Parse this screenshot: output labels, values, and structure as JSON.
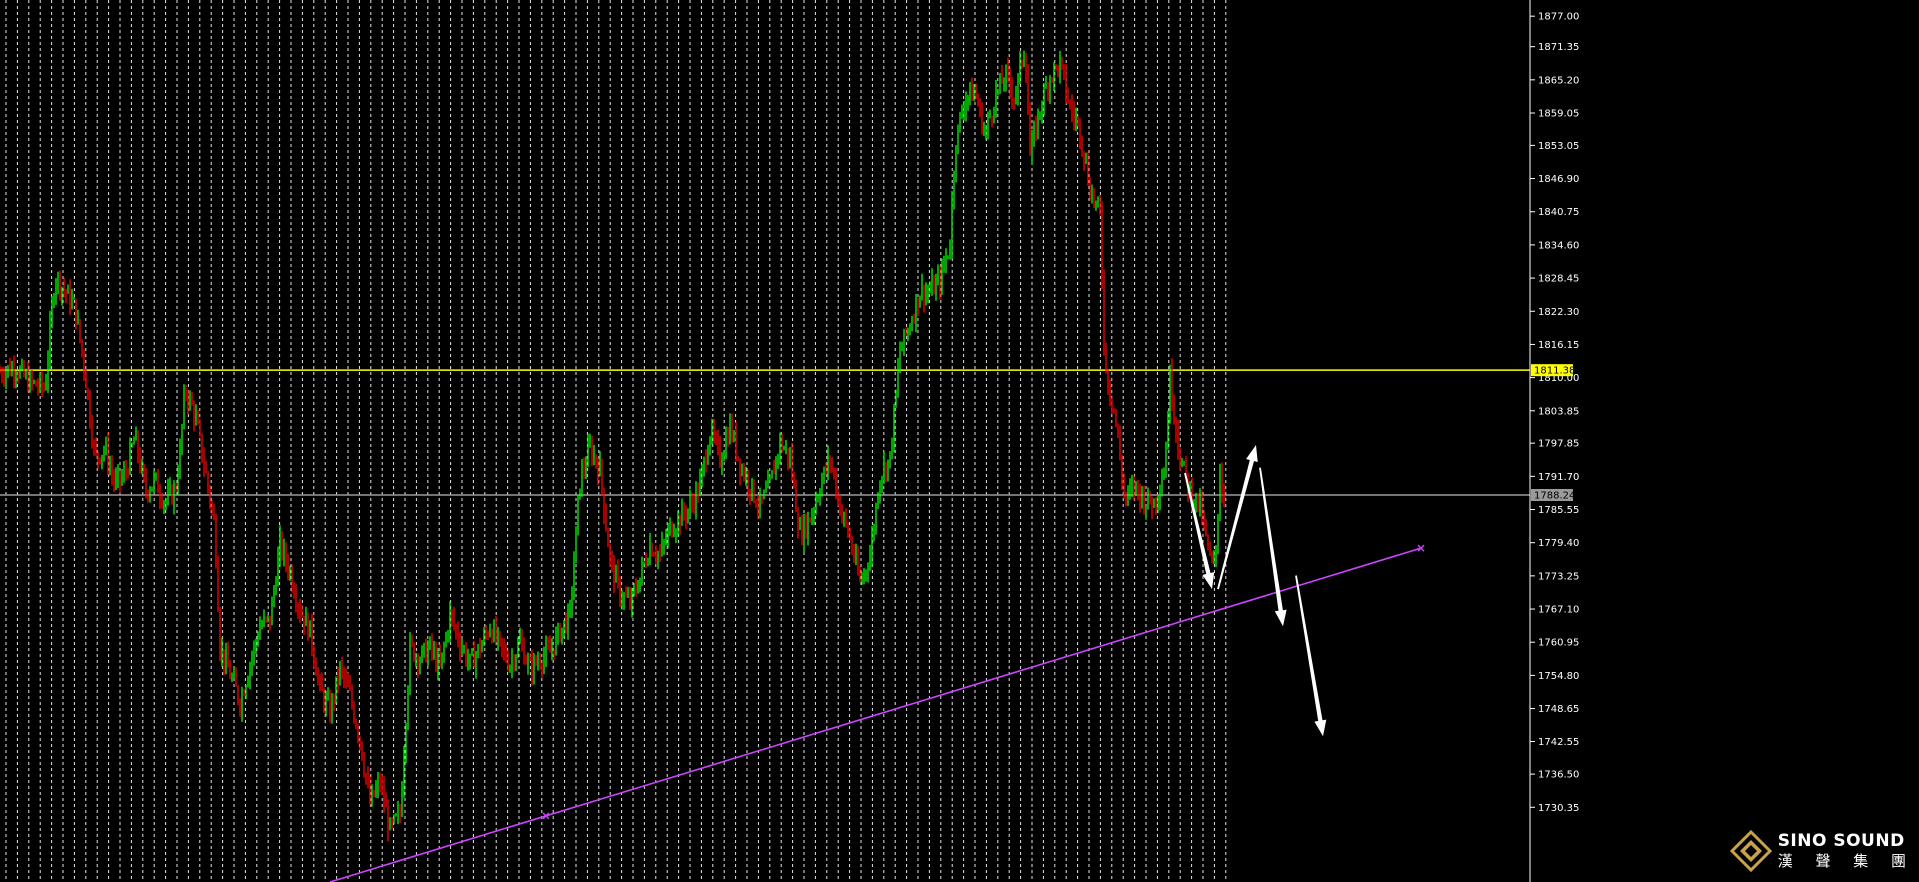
{
  "chart_data": {
    "type": "line",
    "series_style": "bar-ohlc",
    "background": "#000000",
    "up_color": "#00ff00",
    "down_color": "#ff0000",
    "grid_color": "#ffffff",
    "grid": true,
    "ylim": [
      1716.5,
      1880.0
    ],
    "y_ticks": [
      "1877.00",
      "1871.35",
      "1865.20",
      "1859.05",
      "1853.05",
      "1846.90",
      "1840.75",
      "1834.60",
      "1828.45",
      "1822.30",
      "1816.15",
      "1810.00",
      "1803.85",
      "1797.85",
      "1791.70",
      "1785.55",
      "1779.40",
      "1773.25",
      "1767.10",
      "1760.95",
      "1754.80",
      "1748.65",
      "1742.55",
      "1736.50",
      "1730.35"
    ],
    "price_path": [
      [
        0,
        1811
      ],
      [
        15,
        1812
      ],
      [
        30,
        1809
      ],
      [
        45,
        1808
      ],
      [
        55,
        1829
      ],
      [
        65,
        1826
      ],
      [
        75,
        1823
      ],
      [
        85,
        1811
      ],
      [
        95,
        1795
      ],
      [
        105,
        1797
      ],
      [
        115,
        1790
      ],
      [
        125,
        1792
      ],
      [
        135,
        1799
      ],
      [
        145,
        1789
      ],
      [
        155,
        1791
      ],
      [
        165,
        1787
      ],
      [
        175,
        1789
      ],
      [
        180,
        1796
      ],
      [
        185,
        1808
      ],
      [
        195,
        1803
      ],
      [
        205,
        1793
      ],
      [
        215,
        1782
      ],
      [
        220,
        1760
      ],
      [
        230,
        1755
      ],
      [
        240,
        1750
      ],
      [
        250,
        1757
      ],
      [
        260,
        1764
      ],
      [
        270,
        1765
      ],
      [
        280,
        1779
      ],
      [
        290,
        1774
      ],
      [
        300,
        1767
      ],
      [
        310,
        1763
      ],
      [
        320,
        1752
      ],
      [
        330,
        1748
      ],
      [
        340,
        1756
      ],
      [
        350,
        1751
      ],
      [
        360,
        1743
      ],
      [
        370,
        1731
      ],
      [
        380,
        1735
      ],
      [
        390,
        1726
      ],
      [
        400,
        1729
      ],
      [
        410,
        1760
      ],
      [
        420,
        1758
      ],
      [
        430,
        1760
      ],
      [
        440,
        1756
      ],
      [
        450,
        1766
      ],
      [
        460,
        1761
      ],
      [
        470,
        1757
      ],
      [
        480,
        1760
      ],
      [
        490,
        1764
      ],
      [
        500,
        1760
      ],
      [
        510,
        1757
      ],
      [
        520,
        1761
      ],
      [
        530,
        1756
      ],
      [
        540,
        1758
      ],
      [
        550,
        1759
      ],
      [
        560,
        1763
      ],
      [
        570,
        1766
      ],
      [
        580,
        1791
      ],
      [
        590,
        1797
      ],
      [
        600,
        1793
      ],
      [
        610,
        1776
      ],
      [
        620,
        1770
      ],
      [
        630,
        1768
      ],
      [
        640,
        1773
      ],
      [
        650,
        1779
      ],
      [
        660,
        1777
      ],
      [
        670,
        1782
      ],
      [
        680,
        1784
      ],
      [
        690,
        1786
      ],
      [
        700,
        1790
      ],
      [
        710,
        1800
      ],
      [
        720,
        1795
      ],
      [
        730,
        1801
      ],
      [
        740,
        1794
      ],
      [
        750,
        1790
      ],
      [
        760,
        1786
      ],
      [
        770,
        1790
      ],
      [
        780,
        1798
      ],
      [
        790,
        1795
      ],
      [
        800,
        1781
      ],
      [
        810,
        1784
      ],
      [
        820,
        1790
      ],
      [
        830,
        1795
      ],
      [
        840,
        1786
      ],
      [
        850,
        1780
      ],
      [
        860,
        1772
      ],
      [
        870,
        1777
      ],
      [
        880,
        1792
      ],
      [
        890,
        1795
      ],
      [
        900,
        1815
      ],
      [
        910,
        1820
      ],
      [
        920,
        1826
      ],
      [
        930,
        1826
      ],
      [
        940,
        1828
      ],
      [
        950,
        1835
      ],
      [
        955,
        1853
      ],
      [
        965,
        1862
      ],
      [
        975,
        1863
      ],
      [
        985,
        1855
      ],
      [
        995,
        1862
      ],
      [
        1005,
        1866
      ],
      [
        1015,
        1862
      ],
      [
        1025,
        1872
      ],
      [
        1030,
        1851
      ],
      [
        1040,
        1860
      ],
      [
        1050,
        1866
      ],
      [
        1060,
        1868
      ],
      [
        1070,
        1860
      ],
      [
        1080,
        1856
      ],
      [
        1090,
        1845
      ],
      [
        1100,
        1840
      ],
      [
        1105,
        1812
      ],
      [
        1115,
        1803
      ],
      [
        1125,
        1787
      ],
      [
        1135,
        1790
      ],
      [
        1145,
        1787
      ],
      [
        1155,
        1787
      ],
      [
        1165,
        1794
      ],
      [
        1170,
        1810
      ],
      [
        1180,
        1795
      ],
      [
        1190,
        1789
      ],
      [
        1200,
        1786
      ],
      [
        1210,
        1776
      ],
      [
        1215,
        1775
      ],
      [
        1220,
        1793
      ],
      [
        1225,
        1785
      ]
    ],
    "horizontal_lines": [
      {
        "value": 1811.38,
        "label": "1811.38",
        "color": "#ffff00"
      },
      {
        "value": 1788.24,
        "label": "1788.24",
        "color": "#9a9a9a"
      }
    ],
    "trendline": {
      "points": [
        [
          330,
          1716.5
        ],
        [
          1421,
          1778.4
        ]
      ],
      "color": "#cc44ff",
      "markers": [
        546,
        1421
      ]
    },
    "arrows": [
      {
        "from": [
          1185,
          1792.3
        ],
        "to": [
          1212,
          1770.8
        ],
        "color": "#ffffff"
      },
      {
        "from": [
          1218,
          1770.8
        ],
        "to": [
          1256,
          1797.5
        ],
        "color": "#ffffff"
      },
      {
        "from": [
          1260,
          1793.3
        ],
        "to": [
          1283,
          1763.9
        ],
        "color": "#ffffff"
      },
      {
        "from": [
          1296,
          1773.3
        ],
        "to": [
          1323,
          1743.5
        ],
        "color": "#ffffff"
      }
    ]
  },
  "logo": {
    "text_en": "SINO SOUND",
    "text_cn": "漢 聲 集 團",
    "mark_icon": "diamond-logo-icon"
  }
}
